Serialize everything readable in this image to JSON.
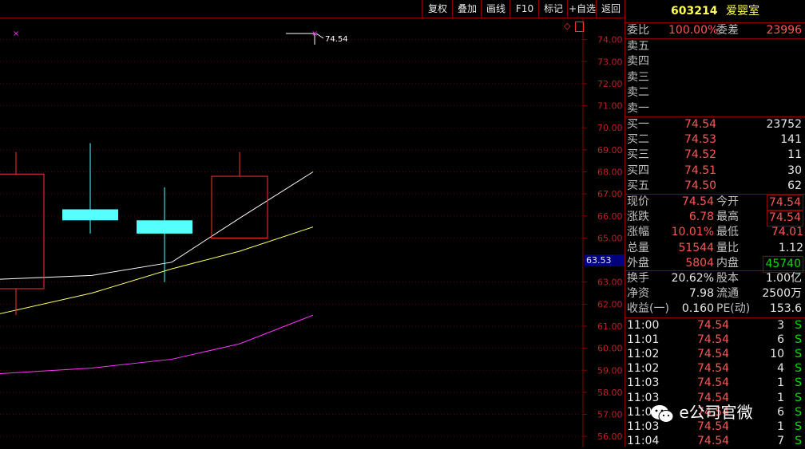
{
  "toolbar": {
    "buttons": [
      "复权",
      "叠加",
      "画线",
      "F10",
      "标记",
      "+自选",
      "返回"
    ]
  },
  "chart": {
    "current_price_label": "63.53",
    "max_marker_label": "74.54",
    "y_axis_ticks": [
      "74.00",
      "73.00",
      "72.00",
      "71.00",
      "70.00",
      "69.00",
      "68.00",
      "67.00",
      "66.00",
      "65.00",
      "63.00",
      "62.00",
      "61.00",
      "60.00",
      "59.00",
      "58.00",
      "57.00",
      "56.00"
    ]
  },
  "chart_data": {
    "type": "candlestick",
    "ylim": [
      55.5,
      75.0
    ],
    "candles": [
      {
        "open": 62.7,
        "close": 67.9,
        "high": 68.9,
        "low": 61.5,
        "color": "up"
      },
      {
        "open": 65.8,
        "close": 66.3,
        "high": 69.3,
        "low": 65.2,
        "color": "down"
      },
      {
        "open": 65.2,
        "close": 65.8,
        "high": 67.3,
        "low": 63.0,
        "color": "down"
      },
      {
        "open": 65.0,
        "close": 67.8,
        "high": 68.9,
        "low": 65.0,
        "color": "up"
      }
    ],
    "ma_lines": [
      {
        "color": "#ffffff",
        "values": [
          63.1,
          63.3,
          63.9,
          65.9,
          68.0
        ]
      },
      {
        "color": "#ffff66",
        "values": [
          61.4,
          62.5,
          63.6,
          64.4,
          65.5
        ]
      },
      {
        "color": "#ff33ff",
        "values": [
          58.8,
          59.1,
          59.5,
          60.2,
          61.5
        ]
      }
    ]
  },
  "quote": {
    "code": "603214",
    "name": "爱婴室",
    "weibi_label": "委比",
    "weibi_value": "100.00%",
    "weicha_label": "委差",
    "weicha_value": "23996",
    "sell_labels": [
      "卖五",
      "卖四",
      "卖三",
      "卖二",
      "卖一"
    ],
    "buys": [
      {
        "label": "买一",
        "price": "74.54",
        "vol": "23752"
      },
      {
        "label": "买二",
        "price": "74.53",
        "vol": "141"
      },
      {
        "label": "买三",
        "price": "74.52",
        "vol": "11"
      },
      {
        "label": "买四",
        "price": "74.51",
        "vol": "30"
      },
      {
        "label": "买五",
        "price": "74.50",
        "vol": "62"
      }
    ],
    "stats": [
      {
        "l1": "现价",
        "v1": "74.54",
        "l2": "今开",
        "v2": "74.54"
      },
      {
        "l1": "涨跌",
        "v1": "6.78",
        "l2": "最高",
        "v2": "74.54"
      },
      {
        "l1": "涨幅",
        "v1": "10.01%",
        "l2": "最低",
        "v2": "74.01"
      },
      {
        "l1": "总量",
        "v1": "51544",
        "l2": "量比",
        "v2": "1.12"
      },
      {
        "l1": "外盘",
        "v1": "5804",
        "l2": "内盘",
        "v2": "45740"
      }
    ],
    "fund": [
      {
        "l1": "换手",
        "v1": "20.62%",
        "l2": "股本",
        "v2": "1.00亿"
      },
      {
        "l1": "净资",
        "v1": "7.98",
        "l2": "流通",
        "v2": "2500万"
      },
      {
        "l1": "收益(一)",
        "v1": "0.160",
        "l2": "PE(动)",
        "v2": "153.6"
      }
    ],
    "ticks": [
      {
        "time": "11:00",
        "price": "74.54",
        "vol": "3",
        "side": "S"
      },
      {
        "time": "11:01",
        "price": "74.54",
        "vol": "6",
        "side": "S"
      },
      {
        "time": "11:02",
        "price": "74.54",
        "vol": "10",
        "side": "S"
      },
      {
        "time": "11:02",
        "price": "74.54",
        "vol": "4",
        "side": "S"
      },
      {
        "time": "11:03",
        "price": "74.54",
        "vol": "1",
        "side": "S"
      },
      {
        "time": "11:03",
        "price": "74.54",
        "vol": "1",
        "side": "S"
      },
      {
        "time": "11:03",
        "price": "74.54",
        "vol": "6",
        "side": "S"
      },
      {
        "time": "11:03",
        "price": "74.54",
        "vol": "1",
        "side": "S"
      },
      {
        "time": "11:04",
        "price": "74.54",
        "vol": "7",
        "side": "S"
      }
    ]
  },
  "watermark": {
    "text": "e公司官微"
  }
}
